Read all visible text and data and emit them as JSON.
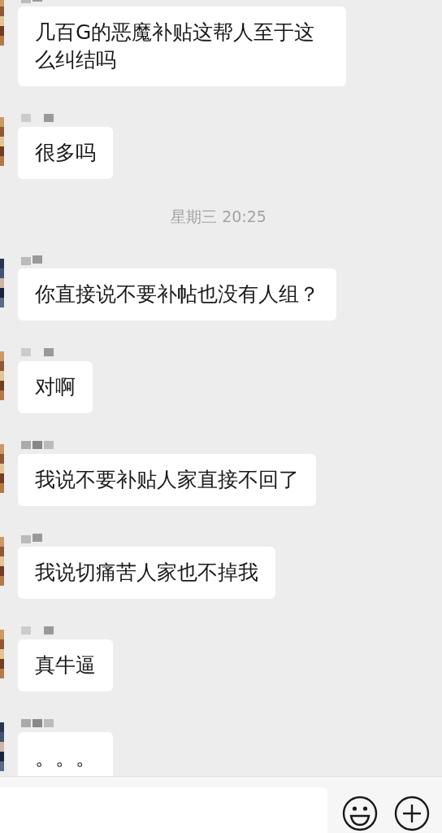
{
  "chat": [
    {
      "kind": "message",
      "text": "几百G的恶魔补贴这帮人至于这么纠结吗"
    },
    {
      "kind": "message",
      "text": "很多吗"
    },
    {
      "kind": "timestamp",
      "text": "星期三 20:25"
    },
    {
      "kind": "message",
      "text": "你直接说不要补帖也没有人组？"
    },
    {
      "kind": "message",
      "text": "对啊"
    },
    {
      "kind": "message",
      "text": "我说不要补贴人家直接不回了"
    },
    {
      "kind": "message",
      "text": "我说切痛苦人家也不掉我"
    },
    {
      "kind": "message",
      "text": "真牛逼"
    },
    {
      "kind": "message",
      "text": "。。。"
    }
  ],
  "input_bar": {
    "field": {
      "kind": "text"
    }
  }
}
